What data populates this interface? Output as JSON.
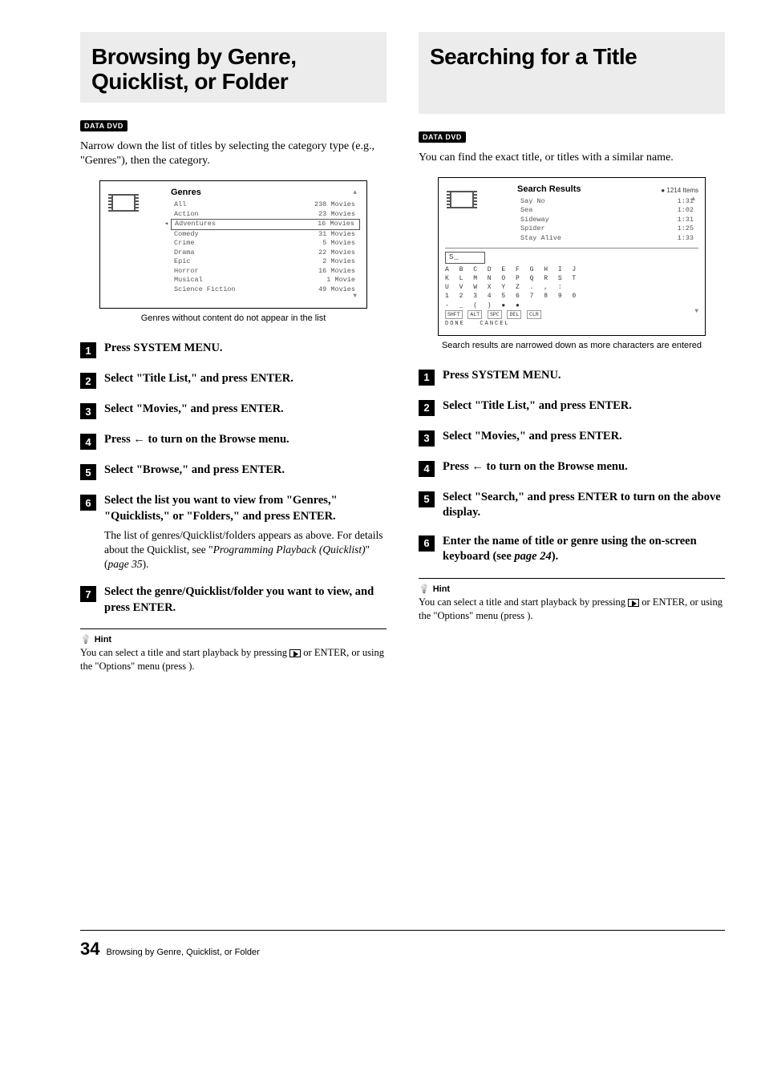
{
  "left": {
    "heading": "Browsing by Genre, Quicklist, or Folder",
    "badge": "DATA DVD",
    "intro": "Narrow down the list of titles by selecting the category type (e.g., \"Genres\"), then the category.",
    "panel": {
      "title": "Genres",
      "rows": [
        {
          "name": "All",
          "count": "238 Movies"
        },
        {
          "name": "Action",
          "count": "23 Movies"
        },
        {
          "name": "Adventures",
          "count": "16 Movies",
          "selected": true
        },
        {
          "name": "Comedy",
          "count": "31 Movies"
        },
        {
          "name": "Crime",
          "count": "5 Movies"
        },
        {
          "name": "Drama",
          "count": "22 Movies"
        },
        {
          "name": "Epic",
          "count": "2 Movies"
        },
        {
          "name": "Horror",
          "count": "16 Movies"
        },
        {
          "name": "Musical",
          "count": "1 Movie"
        },
        {
          "name": "Science Fiction",
          "count": "49 Movies"
        }
      ]
    },
    "caption": "Genres without content do not appear in the list",
    "steps": {
      "s1": "Press SYSTEM MENU.",
      "s2": "Select \"Title List,\" and press ENTER.",
      "s3": "Select \"Movies,\" and press ENTER.",
      "s4a": "Press ",
      "s4b": " to turn on the Browse menu.",
      "s5": "Select \"Browse,\" and press ENTER.",
      "s6": "Select the list you want to view from \"Genres,\" \"Quicklists,\" or \"Folders,\" and press ENTER.",
      "s6sub_a": "The list of genres/Quicklist/folders appears as above. For details about the Quicklist, see \"",
      "s6sub_i": "Programming Playback (Quicklist)",
      "s6sub_b": "\" (",
      "s6sub_c": "page 35",
      "s6sub_d": ").",
      "s7": "Select the genre/Quicklist/folder you want to view, and press ENTER."
    },
    "hint_label": "Hint",
    "hint_a": "You can select a title and start playback by pressing ",
    "hint_b": " or ENTER, or using the \"Options\" menu (press ",
    "hint_c": ")."
  },
  "right": {
    "heading": "Searching for a Title",
    "badge": "DATA DVD",
    "intro": "You can find the exact title, or titles with a similar name.",
    "panel": {
      "title": "Search Results",
      "count_label": "1214 Items",
      "rows": [
        {
          "name": "Say No",
          "time": "1:31"
        },
        {
          "name": "Sea",
          "time": "1:02"
        },
        {
          "name": "Sideway",
          "time": "1:31"
        },
        {
          "name": "Spider",
          "time": "1:25"
        },
        {
          "name": "Stay Alive",
          "time": "1:33"
        }
      ],
      "search_value": "S_",
      "kb_line1": "A B C D E F G H I J",
      "kb_line2": "K L M N O P Q R S T",
      "kb_line3": "U V W X Y Z   . , :",
      "kb_line4": "1 2 3 4 5 6 7 8 9 0",
      "kb_line5": "- _ ( )       ● ●",
      "kb_btn1": "SHFT",
      "kb_btn2": "ALT",
      "kb_btn3": "SPC",
      "kb_btn4": "DEL",
      "kb_btn5": "CLR",
      "kb_done": "DONE",
      "kb_cancel": "CANCEL"
    },
    "caption": "Search results are narrowed down as more characters are entered",
    "steps": {
      "s1": "Press SYSTEM MENU.",
      "s2": "Select \"Title List,\" and press ENTER.",
      "s3": "Select \"Movies,\" and press ENTER.",
      "s4a": "Press ",
      "s4b": " to turn on the Browse menu.",
      "s5": "Select \"Search,\" and press ENTER to turn on the above display.",
      "s6a": "Enter the name of title or genre using the on-screen keyboard (see ",
      "s6b": "page 24",
      "s6c": ")."
    },
    "hint_label": "Hint",
    "hint_a": "You can select a title and start playback by pressing ",
    "hint_b": " or ENTER, or using the \"Options\" menu (press ",
    "hint_c": ")."
  },
  "footer": {
    "page": "34",
    "title": "Browsing by Genre, Quicklist, or Folder"
  }
}
